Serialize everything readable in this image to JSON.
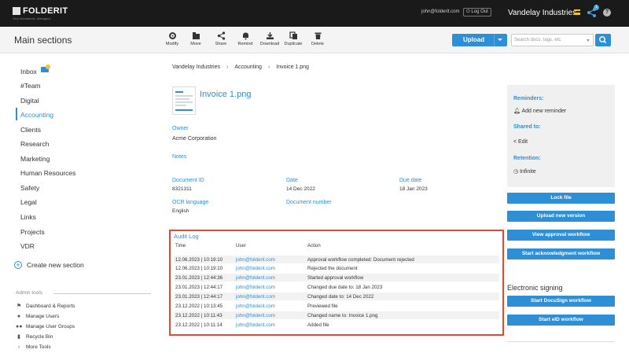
{
  "topbar": {
    "logo": "FOLDERIT",
    "tagline": "Your documents. Managed.",
    "email": "john@folderit.com",
    "logout": "Log Out",
    "org": "Vandelay Industries",
    "share_count": "1",
    "help": "?"
  },
  "toolbar": {
    "title": "Main sections",
    "tools": [
      "Modify",
      "Move",
      "Share",
      "Remind",
      "Download",
      "Duplicate",
      "Delete"
    ],
    "upload_label": "Upload",
    "search_placeholder": "Search docs, tags, etc"
  },
  "sidebar": {
    "items": [
      "Inbox",
      "#Team",
      "Digital",
      "Accounting",
      "Clients",
      "Research",
      "Marketing",
      "Human Resources",
      "Safety",
      "Legal",
      "Links",
      "Projects",
      "VDR"
    ],
    "create_section": "Create new section",
    "admin_title": "Admin tools",
    "admin_items": [
      "Dashboard & Reports",
      "Manage Users",
      "Manage User Groups",
      "Recycle Bin",
      "More Tools"
    ]
  },
  "breadcrumb": [
    "Vandelay Industries",
    "Accounting",
    "Invoice 1.png"
  ],
  "document": {
    "title": "Invoice 1.png",
    "owner_label": "Owner",
    "owner": "Acme Corporation",
    "notes_label": "Notes",
    "docid_label": "Document ID",
    "docid": "8321311",
    "date_label": "Date",
    "date": "14 Dec 2022",
    "due_label": "Due date",
    "due": "18 Jan 2023",
    "ocr_label": "OCR language",
    "ocr": "English",
    "docnum_label": "Document number"
  },
  "audit": {
    "title": "Audit Log",
    "headers": [
      "Time",
      "User",
      "Action"
    ],
    "rows": [
      {
        "time": "12.06.2023 | 10:19:10",
        "user": "john@folderit.com",
        "action": "Approval workflow completed: Document rejected"
      },
      {
        "time": "12.06.2023 | 10:19:10",
        "user": "john@folderit.com",
        "action": "Rejected the document"
      },
      {
        "time": "23.01.2023 | 12:44:36",
        "user": "john@folderit.com",
        "action": "Started approval workflow"
      },
      {
        "time": "23.01.2023 | 12:44:17",
        "user": "john@folderit.com",
        "action": "Changed due date to: 18 Jan 2023"
      },
      {
        "time": "23.01.2023 | 12:44:17",
        "user": "john@folderit.com",
        "action": "Changed date to: 14 Dec 2022"
      },
      {
        "time": "23.12.2022 | 10:13:45",
        "user": "john@folderit.com",
        "action": "Previewed file"
      },
      {
        "time": "23.12.2022 | 10:11:43",
        "user": "john@folderit.com",
        "action": "Changed name to: Invoice 1.png"
      },
      {
        "time": "23.12.2022 | 10:11:14",
        "user": "john@folderit.com",
        "action": "Added file"
      }
    ]
  },
  "right": {
    "reminders_label": "Reminders:",
    "add_reminder": "Add new reminder",
    "shared_label": "Shared to:",
    "edit": "Edit",
    "retention_label": "Retention:",
    "retention": "Infinite",
    "buttons": [
      "Lock file",
      "Upload new version",
      "View approval workflow",
      "Start acknowledgment workflow"
    ],
    "esign_title": "Electronic signing",
    "esign_buttons": [
      "Start DocuSign workflow",
      "Start eID workflow"
    ]
  },
  "colors": {
    "accent": "#2f8fd6",
    "highlight": "#e04b2f",
    "topbar": "#1a1a1a"
  }
}
